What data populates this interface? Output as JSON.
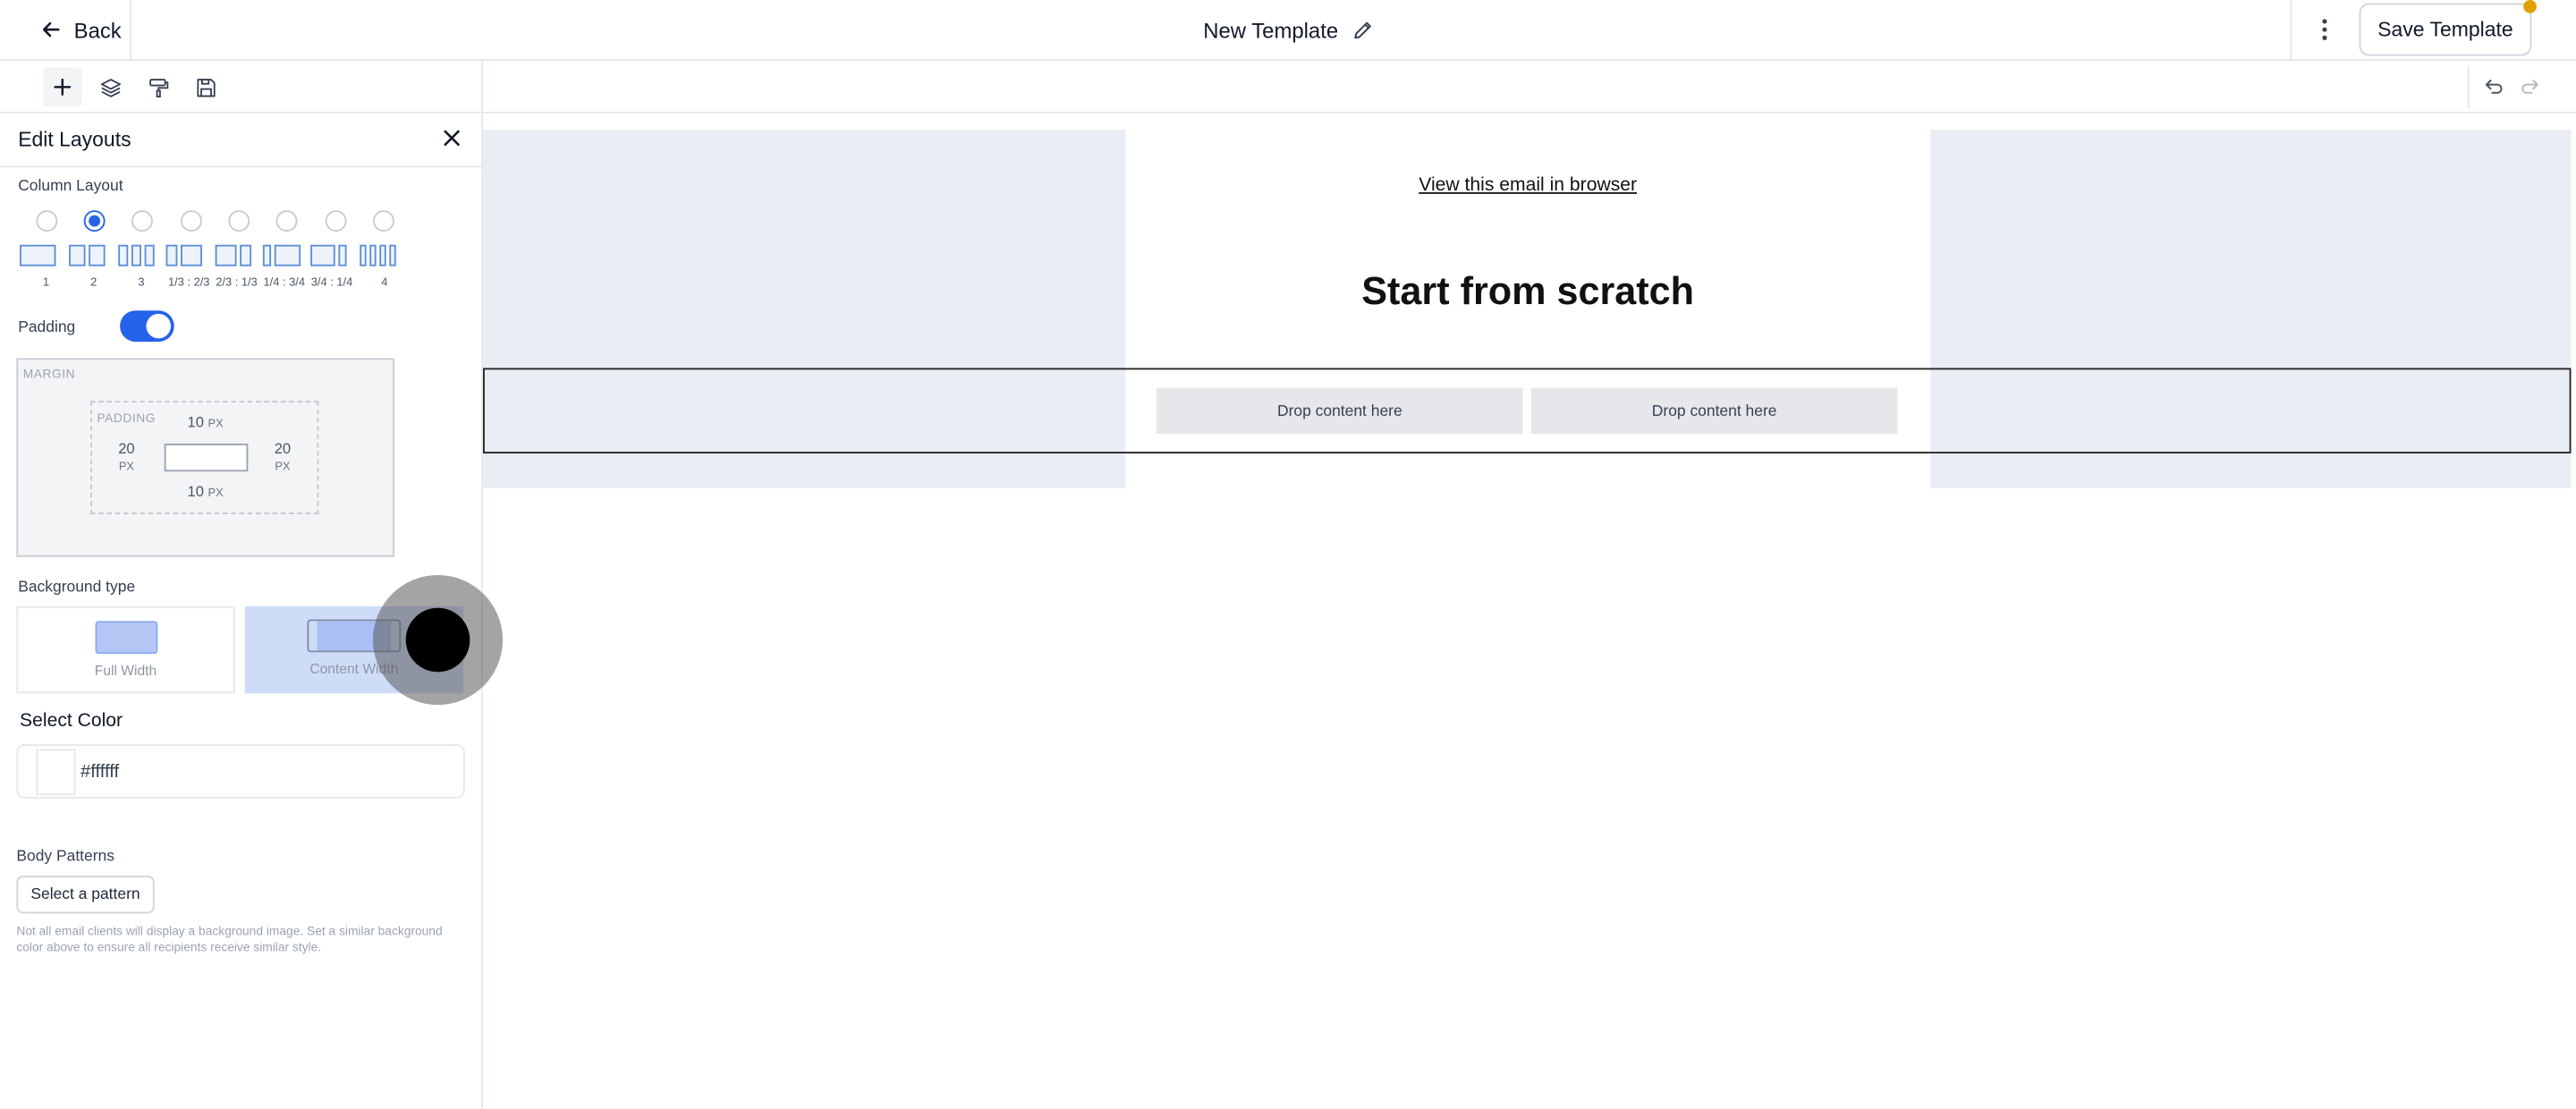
{
  "header": {
    "back_label": "Back",
    "title": "New Template",
    "save_label": "Save Template"
  },
  "panel": {
    "title": "Edit Layouts",
    "column_layout": {
      "label": "Column Layout",
      "selected_index": 1,
      "options": [
        "1",
        "2",
        "3",
        "1/3 : 2/3",
        "2/3 : 1/3",
        "1/4 : 3/4",
        "3/4 : 1/4",
        "4"
      ]
    },
    "padding": {
      "label": "Padding",
      "enabled": true,
      "margin_label": "MARGIN",
      "padding_label": "PADDING",
      "top": "10",
      "bottom": "10",
      "left": "20",
      "right": "20",
      "unit": "PX"
    },
    "background_type": {
      "label": "Background type",
      "options": [
        "Full Width",
        "Content Width"
      ],
      "selected": "Content Width"
    },
    "select_color": {
      "label": "Select Color",
      "value": "#ffffff"
    },
    "body_patterns": {
      "label": "Body Patterns",
      "button_label": "Select a pattern",
      "help_text": "Not all email clients will display a background image. Set a similar background color above to ensure all recipients receive similar style."
    }
  },
  "canvas": {
    "view_in_browser": "View this email in browser",
    "headline": "Start from scratch",
    "drop_left": "Drop content here",
    "drop_right": "Drop content here"
  },
  "colors": {
    "accent": "#2563eb",
    "canvas_bg": "#e9edf4",
    "notification": "#e0a100"
  }
}
